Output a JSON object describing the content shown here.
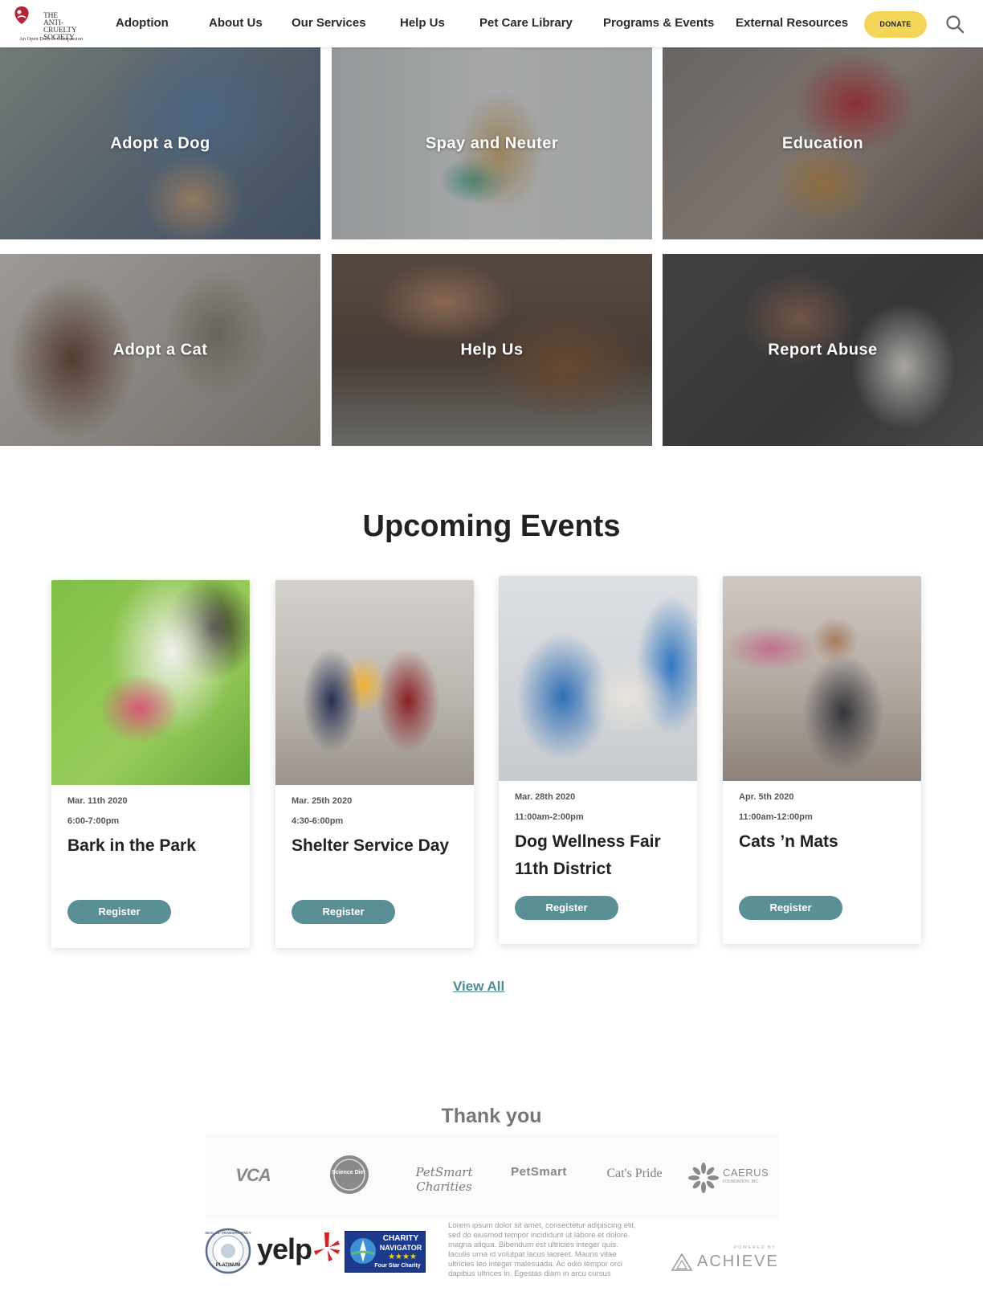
{
  "header": {
    "logo_lines": [
      "THE",
      "ANTI-CRUELTY",
      "SOCIETY"
    ],
    "logo_tagline": "An Open Door to Compassion",
    "nav": [
      {
        "label": "Adoption"
      },
      {
        "label": "About Us"
      },
      {
        "label": "Our Services"
      },
      {
        "label": "Help Us"
      },
      {
        "label": "Pet Care Library"
      },
      {
        "label": "Programs & Events"
      },
      {
        "label": "External Resources"
      }
    ],
    "donate_label": "DONATE",
    "search_icon": "search-icon",
    "colors": {
      "donate": "#f3d658"
    }
  },
  "tiles": [
    {
      "label": "Adopt a Dog"
    },
    {
      "label": "Spay and Neuter"
    },
    {
      "label": "Education"
    },
    {
      "label": "Adopt a Cat"
    },
    {
      "label": "Help Us"
    },
    {
      "label": "Report Abuse"
    }
  ],
  "events": {
    "title": "Upcoming Events",
    "cards": [
      {
        "date": "Mar. 11th 2020",
        "time": "6:00-7:00pm",
        "title": "Bark in the Park",
        "button": "Register"
      },
      {
        "date": "Mar. 25th 2020",
        "time": " 4:30-6:00pm",
        "title": "Shelter Service Day",
        "button": "Register"
      },
      {
        "date": "Mar. 28th 2020",
        "time": "11:00am-2:00pm",
        "title": "Dog Wellness Fair 11th District",
        "button": "Register"
      },
      {
        "date": "Apr. 5th 2020",
        "time": "11:00am-12:00pm",
        "title": "Cats ’n Mats",
        "button": "Register"
      }
    ],
    "view_all": "View All",
    "colors": {
      "button": "#5b8f96",
      "link": "#4e8a92"
    }
  },
  "thanks": {
    "title": "Thank you",
    "sponsors": [
      {
        "name": "VCA"
      },
      {
        "name": "Science Diet"
      },
      {
        "name": "PetSmart Charities"
      },
      {
        "name": "PetSmart"
      },
      {
        "name": "Cat's Pride"
      },
      {
        "name": "CAERUS",
        "sub": "FOUNDATION, INC."
      }
    ],
    "badges": {
      "transparency_title": "SEAL OF TRANSPARENCY",
      "transparency_level": "PLATINUM",
      "yelp": "yelp",
      "charity_nav_line1": "CHARITY",
      "charity_nav_line2": "NAVIGATOR",
      "charity_nav_line3": "Four Star Charity"
    },
    "lorem": "Lorem ipsum dolor sit amet, consectetur adipiscing elit, sed do eiusmod tempor incididunt ut labore et dolore magna aliqua. Bibendum est ultricies integer quis. Iaculis urna id volutpat lacus laoreet. Mauris vitae ultricies leo integer malesuada. Ac odio tempor orci dapibus ultrices in. Egestas diam in arcu cursus",
    "powered_by": "POWERED BY",
    "achieve": "ACHIEVE"
  }
}
